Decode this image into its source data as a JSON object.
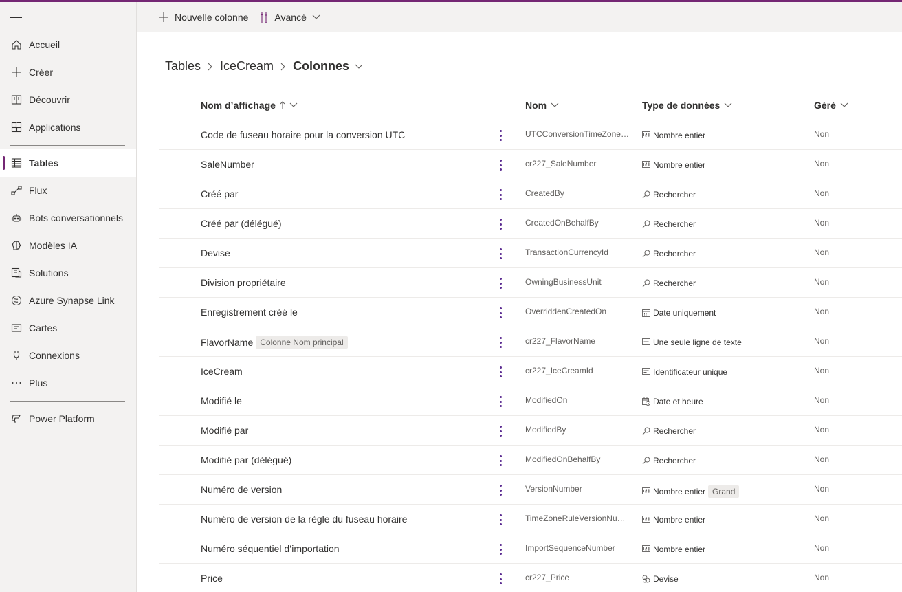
{
  "sidebar": {
    "items": [
      {
        "label": "Accueil",
        "icon": "home-icon"
      },
      {
        "label": "Créer",
        "icon": "plus-icon"
      },
      {
        "label": "Découvrir",
        "icon": "book-icon"
      },
      {
        "label": "Applications",
        "icon": "apps-icon"
      },
      {
        "label": "Tables",
        "icon": "table-icon",
        "active": true
      },
      {
        "label": "Flux",
        "icon": "flow-icon"
      },
      {
        "label": "Bots conversationnels",
        "icon": "bot-icon"
      },
      {
        "label": "Modèles IA",
        "icon": "brain-icon"
      },
      {
        "label": "Solutions",
        "icon": "solutions-icon"
      },
      {
        "label": "Azure Synapse Link",
        "icon": "synapse-icon"
      },
      {
        "label": "Cartes",
        "icon": "card-icon"
      },
      {
        "label": "Connexions",
        "icon": "plug-icon"
      },
      {
        "label": "Plus",
        "icon": "ellipsis-icon"
      },
      {
        "label": "Power Platform",
        "icon": "power-platform-icon"
      }
    ]
  },
  "commandbar": {
    "new_column": "Nouvelle colonne",
    "advanced": "Avancé"
  },
  "breadcrumb": {
    "tables": "Tables",
    "table": "IceCream",
    "current": "Colonnes"
  },
  "grid": {
    "headers": {
      "display_name": "Nom d’affichage",
      "name": "Nom",
      "data_type": "Type de données",
      "managed": "Géré"
    },
    "rows": [
      {
        "display": "Code de fuseau horaire pour la conversion UTC",
        "tag": "",
        "name": "UTCConversionTimeZoneC...",
        "type": "Nombre entier",
        "type_icon": "number-icon",
        "type_tag": "",
        "managed": "Non"
      },
      {
        "display": "SaleNumber",
        "tag": "",
        "name": "cr227_SaleNumber",
        "type": "Nombre entier",
        "type_icon": "number-icon",
        "type_tag": "",
        "managed": "Non"
      },
      {
        "display": "Créé par",
        "tag": "",
        "name": "CreatedBy",
        "type": "Rechercher",
        "type_icon": "lookup-icon",
        "type_tag": "",
        "managed": "Non"
      },
      {
        "display": "Créé par (délégué)",
        "tag": "",
        "name": "CreatedOnBehalfBy",
        "type": "Rechercher",
        "type_icon": "lookup-icon",
        "type_tag": "",
        "managed": "Non"
      },
      {
        "display": "Devise",
        "tag": "",
        "name": "TransactionCurrencyId",
        "type": "Rechercher",
        "type_icon": "lookup-icon",
        "type_tag": "",
        "managed": "Non"
      },
      {
        "display": "Division propriétaire",
        "tag": "",
        "name": "OwningBusinessUnit",
        "type": "Rechercher",
        "type_icon": "lookup-icon",
        "type_tag": "",
        "managed": "Non"
      },
      {
        "display": "Enregistrement créé le",
        "tag": "",
        "name": "OverriddenCreatedOn",
        "type": "Date uniquement",
        "type_icon": "calendar-icon",
        "type_tag": "",
        "managed": "Non"
      },
      {
        "display": "FlavorName",
        "tag": "Colonne Nom principal",
        "name": "cr227_FlavorName",
        "type": "Une seule ligne de texte",
        "type_icon": "text-icon",
        "type_tag": "",
        "managed": "Non"
      },
      {
        "display": "IceCream",
        "tag": "",
        "name": "cr227_IceCreamId",
        "type": "Identificateur unique",
        "type_icon": "id-icon",
        "type_tag": "",
        "managed": "Non"
      },
      {
        "display": "Modifié le",
        "tag": "",
        "name": "ModifiedOn",
        "type": "Date et heure",
        "type_icon": "calendar-clock-icon",
        "type_tag": "",
        "managed": "Non"
      },
      {
        "display": "Modifié par",
        "tag": "",
        "name": "ModifiedBy",
        "type": "Rechercher",
        "type_icon": "lookup-icon",
        "type_tag": "",
        "managed": "Non"
      },
      {
        "display": "Modifié par (délégué)",
        "tag": "",
        "name": "ModifiedOnBehalfBy",
        "type": "Rechercher",
        "type_icon": "lookup-icon",
        "type_tag": "",
        "managed": "Non"
      },
      {
        "display": "Numéro de version",
        "tag": "",
        "name": "VersionNumber",
        "type": "Nombre entier",
        "type_icon": "number-icon",
        "type_tag": "Grand",
        "managed": "Non"
      },
      {
        "display": "Numéro de version de la règle du fuseau horaire",
        "tag": "",
        "name": "TimeZoneRuleVersionNum...",
        "type": "Nombre entier",
        "type_icon": "number-icon",
        "type_tag": "",
        "managed": "Non"
      },
      {
        "display": "Numéro séquentiel d’importation",
        "tag": "",
        "name": "ImportSequenceNumber",
        "type": "Nombre entier",
        "type_icon": "number-icon",
        "type_tag": "",
        "managed": "Non"
      },
      {
        "display": "Price",
        "tag": "",
        "name": "cr227_Price",
        "type": "Devise",
        "type_icon": "currency-icon",
        "type_tag": "",
        "managed": "Non"
      }
    ]
  },
  "colors": {
    "accent": "#742774",
    "dots": "#5c2d91"
  }
}
